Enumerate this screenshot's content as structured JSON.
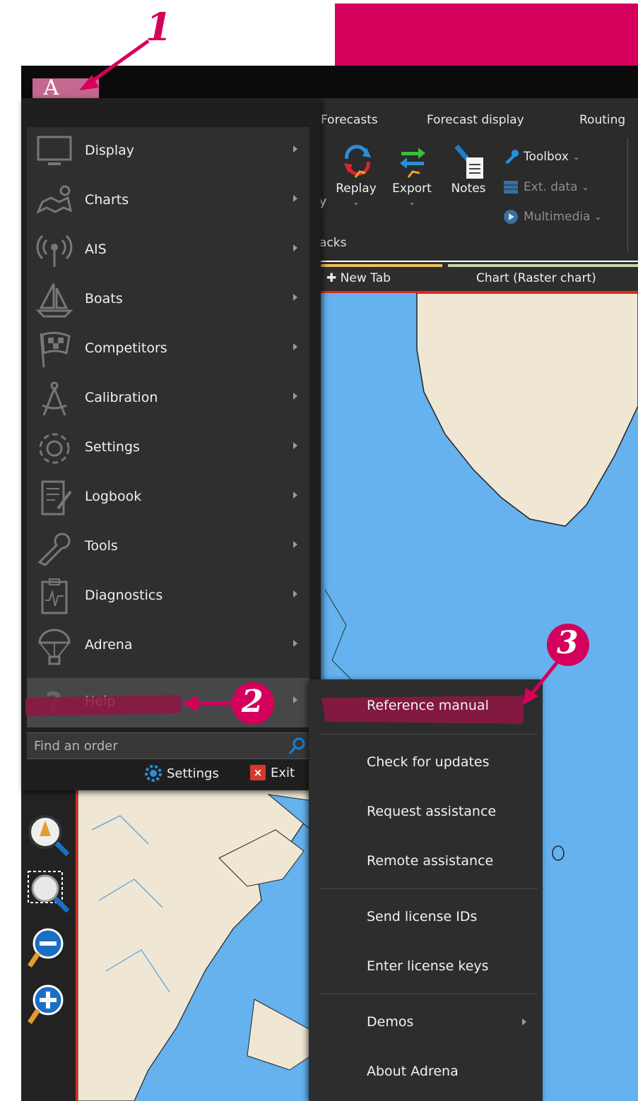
{
  "brand": {
    "logo_letter": "A",
    "accent": "#d5005b"
  },
  "ribbon": {
    "tabs": [
      "Forecasts",
      "Forecast display",
      "Routing"
    ],
    "buttons": [
      {
        "label": "Replay",
        "icon": "replay-icon"
      },
      {
        "label": "Export",
        "icon": "export-icon"
      },
      {
        "label": "Notes",
        "icon": "notes-icon"
      }
    ],
    "side_items": [
      {
        "label": "Toolbox",
        "icon": "wrench-icon"
      },
      {
        "label": "Ext. data",
        "icon": "table-icon"
      },
      {
        "label": "Multimedia",
        "icon": "play-icon"
      }
    ],
    "group_label": "acks",
    "partial_left": "y"
  },
  "doc_tabs": {
    "new_tab": "New Tab",
    "chart_tab": "Chart (Raster chart)"
  },
  "main_menu": {
    "items": [
      {
        "label": "Display",
        "icon": "monitor-icon"
      },
      {
        "label": "Charts",
        "icon": "map-pin-icon"
      },
      {
        "label": "AIS",
        "icon": "antenna-icon"
      },
      {
        "label": "Boats",
        "icon": "sailboat-icon"
      },
      {
        "label": "Competitors",
        "icon": "checkered-flag-icon"
      },
      {
        "label": "Calibration",
        "icon": "compass-tool-icon"
      },
      {
        "label": "Settings",
        "icon": "gear-icon"
      },
      {
        "label": "Logbook",
        "icon": "notebook-icon"
      },
      {
        "label": "Tools",
        "icon": "wrench-icon"
      },
      {
        "label": "Diagnostics",
        "icon": "clipboard-chart-icon"
      },
      {
        "label": "Adrena",
        "icon": "parachute-icon"
      },
      {
        "label": "Help",
        "icon": "question-icon"
      }
    ],
    "find_placeholder": "Find an order",
    "settings_label": "Settings",
    "exit_label": "Exit"
  },
  "help_submenu": {
    "items": [
      "Reference manual",
      "Check for updates",
      "Request assistance",
      "Remote assistance",
      "Send license IDs",
      "Enter license keys",
      "Demos",
      "About Adrena"
    ]
  },
  "annotations": [
    "1",
    "2",
    "3"
  ]
}
